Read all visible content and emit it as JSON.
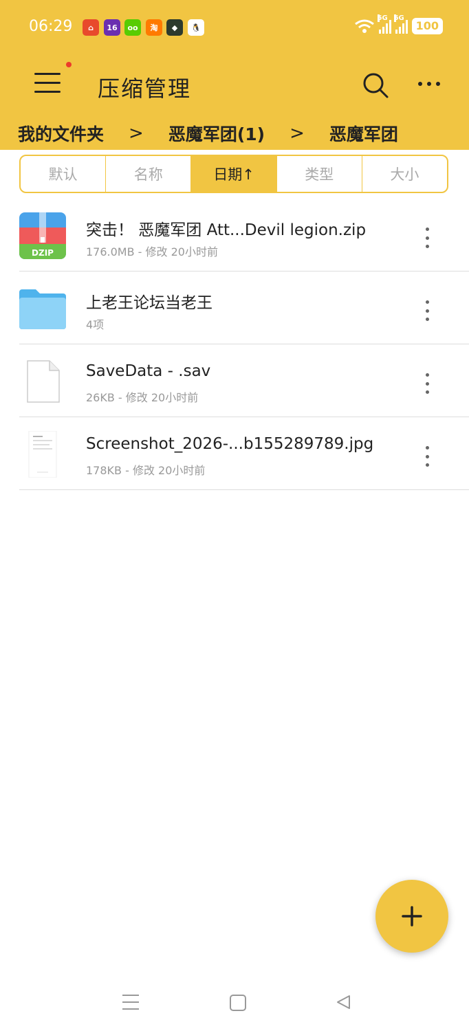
{
  "status_bar": {
    "time": "06:29",
    "network_label_1": "5G",
    "network_label_2": "5G",
    "battery": "100",
    "notification_icons": [
      "app-icon-1",
      "app-icon-2",
      "app-icon-3",
      "app-icon-4",
      "app-icon-5",
      "qq-icon"
    ]
  },
  "app_bar": {
    "title": "压缩管理",
    "menu_icon": "hamburger-icon",
    "search_icon": "search-icon",
    "more_icon": "more-horizontal-icon"
  },
  "breadcrumb": {
    "items": [
      "我的文件夹",
      "恶魔军团(1)",
      "恶魔军团"
    ],
    "separator": ">"
  },
  "sort_tabs": {
    "items": [
      "默认",
      "名称",
      "日期↑",
      "类型",
      "大小"
    ],
    "active": "日期↑"
  },
  "files": [
    {
      "name": "突击！ 恶魔军团 Att...Devil legion.zip",
      "meta": "176.0MB - 修改 20小时前",
      "icon": "dzip-archive-icon",
      "icon_label": "DZIP"
    },
    {
      "name": "上老王论坛当老王",
      "meta": "4项",
      "icon": "folder-icon"
    },
    {
      "name": "SaveData - .sav",
      "meta": "26KB - 修改 20小时前",
      "icon": "document-icon"
    },
    {
      "name": "Screenshot_2026-...b155289789.jpg",
      "meta": "178KB - 修改 20小时前",
      "icon": "image-thumbnail-icon"
    }
  ],
  "fab": {
    "icon": "plus-icon"
  },
  "colors": {
    "accent": "#F1C542",
    "text": "#222222",
    "secondary": "#999999",
    "divider": "#dddddd"
  }
}
